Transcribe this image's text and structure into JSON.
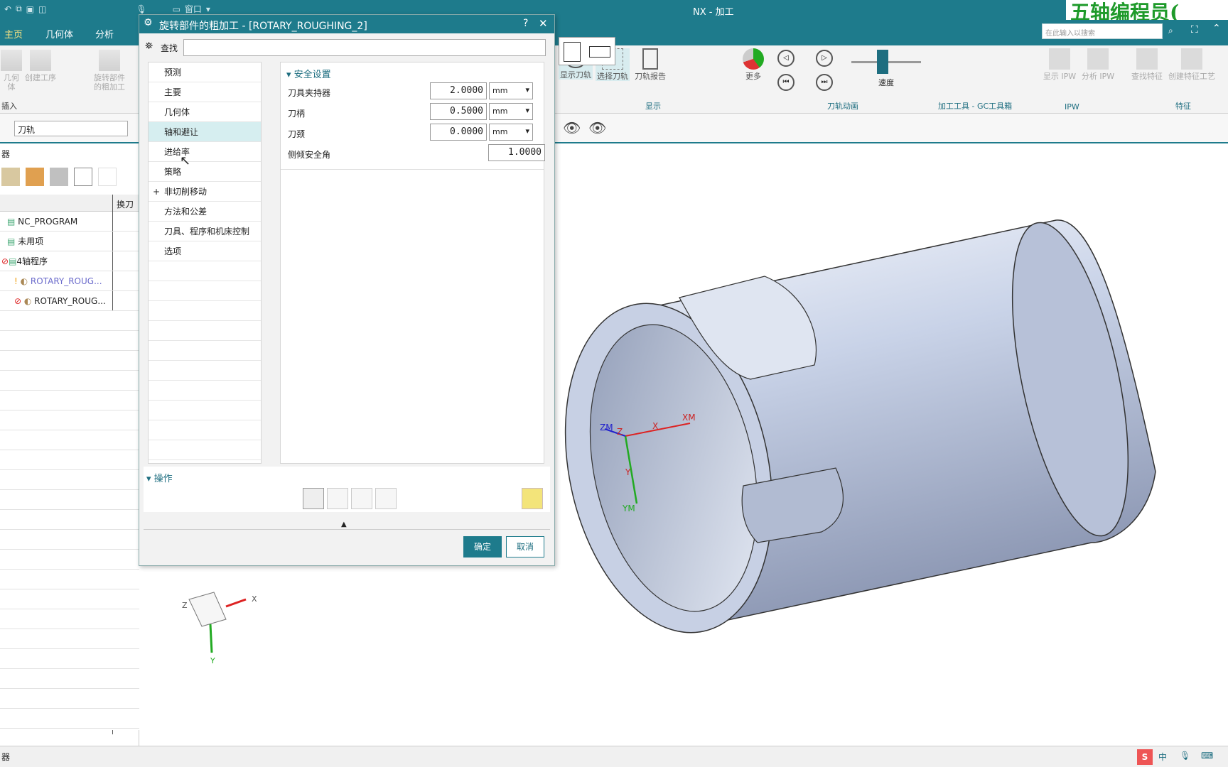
{
  "window": {
    "title": "NX - 加工"
  },
  "quick_access": {
    "window_menu": "窗口"
  },
  "watermark": "五轴编程员(",
  "ribbon_tabs": [
    "主页",
    "几何体",
    "分析"
  ],
  "search": {
    "placeholder": "在此输入以搜索"
  },
  "ribbon": {
    "left_buttons": [
      "几何体",
      "创建工序",
      "旋转部件的粗加工"
    ],
    "insert_group": "插入",
    "display": {
      "show_toolpath": "显示刀轨",
      "select_toolpath": "选择刀轨",
      "toolpath_report": "刀轨报告",
      "more": "更多",
      "group": "显示"
    },
    "animation": {
      "speed": "速度",
      "group": "刀轨动画"
    },
    "gc_group": "加工工具 - GC工具箱",
    "ipw": {
      "show": "显示 IPW",
      "analyze": "分析 IPW",
      "group": "IPW"
    },
    "feature": {
      "find": "查找特征",
      "create": "创建特征工艺",
      "group": "特征"
    }
  },
  "toolbar2": {
    "filter_value": "刀轨"
  },
  "navigator": {
    "title": "器",
    "column_tool_change": "换刀",
    "rows": [
      {
        "label": "NC_PROGRAM"
      },
      {
        "label": "未用项"
      },
      {
        "label": "4轴程序"
      },
      {
        "label": "ROTARY_ROUG...",
        "color": "#6a6acb"
      },
      {
        "label": "ROTARY_ROUG..."
      }
    ]
  },
  "dialog": {
    "title": "旋转部件的粗加工 - [ROTARY_ROUGHING_2]",
    "help": "?",
    "close": "✕",
    "find_label": "查找",
    "tree": [
      "预测",
      "主要",
      "几何体",
      "轴和避让",
      "进给率",
      "策略",
      "非切削移动",
      "方法和公差",
      "刀具、程序和机床控制",
      "选项"
    ],
    "tree_selected": 3,
    "section_title": "安全设置",
    "params": [
      {
        "label": "刀具夹持器",
        "value": "2.0000",
        "unit": "mm"
      },
      {
        "label": "刀柄",
        "value": "0.5000",
        "unit": "mm"
      },
      {
        "label": "刀颈",
        "value": "0.0000",
        "unit": "mm"
      },
      {
        "label": "侧倾安全角",
        "value": "1.0000"
      }
    ],
    "ops_title": "操作",
    "ok": "确定",
    "cancel": "取消"
  },
  "viewport": {
    "csys": {
      "zm": "ZM",
      "z": "Z",
      "x": "X",
      "xm": "XM",
      "y": "Y",
      "ym": "YM"
    },
    "triad": {
      "x": "X",
      "y": "Y",
      "z": "Z"
    }
  },
  "status": {
    "left": "器",
    "ime": "中"
  }
}
